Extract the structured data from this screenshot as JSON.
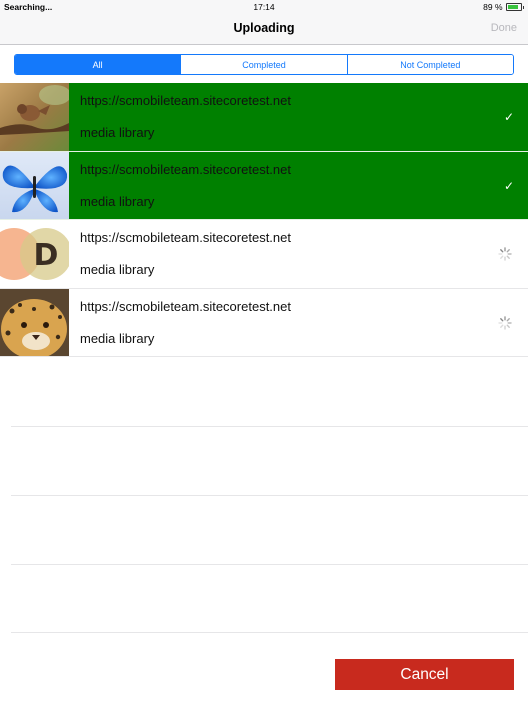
{
  "status_bar": {
    "carrier": "Searching...",
    "time": "17:14",
    "battery": "89 %",
    "battery_level": 0.89
  },
  "nav": {
    "title": "Uploading",
    "done_label": "Done"
  },
  "tabs": [
    {
      "label": "All",
      "active": true
    },
    {
      "label": "Completed",
      "active": false
    },
    {
      "label": "Not Completed",
      "active": false
    }
  ],
  "uploads": [
    {
      "url": "https://scmobileteam.sitecoretest.net",
      "destination": "media library",
      "status": "completed",
      "thumbnail": "bird-photo"
    },
    {
      "url": "https://scmobileteam.sitecoretest.net",
      "destination": "media library",
      "status": "completed",
      "thumbnail": "butterfly-photo"
    },
    {
      "url": "https://scmobileteam.sitecoretest.net",
      "destination": "media library",
      "status": "uploading",
      "thumbnail": "circles-logo-photo"
    },
    {
      "url": "https://scmobileteam.sitecoretest.net",
      "destination": "media library",
      "status": "uploading",
      "thumbnail": "leopard-photo"
    }
  ],
  "thumb_letter": "D",
  "icons": {
    "check": "✓",
    "spinner": "activity-spinner-icon"
  },
  "colors": {
    "accent": "#1479fb",
    "completed_bg": "#008000",
    "cancel_bg": "#c82a1e"
  },
  "cancel_label": "Cancel"
}
